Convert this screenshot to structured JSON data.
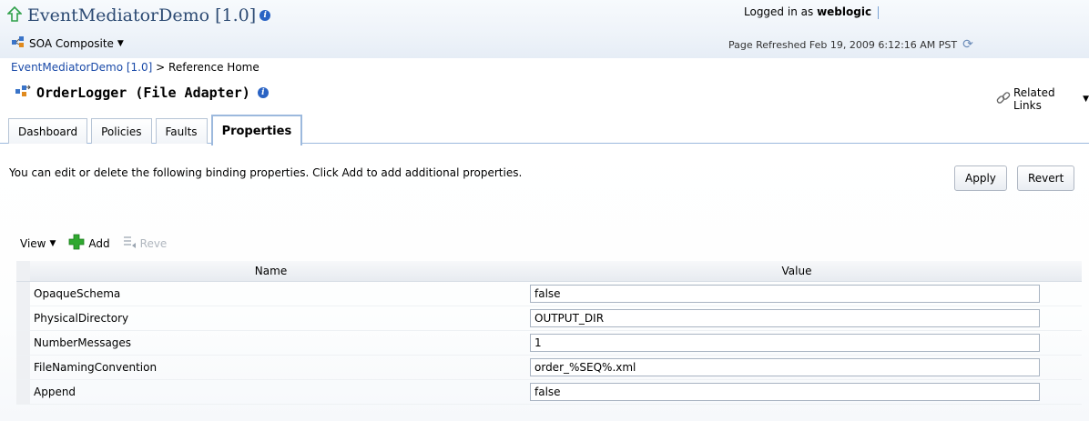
{
  "header": {
    "app_title": "EventMediatorDemo [1.0]",
    "composite_menu_label": "SOA Composite",
    "logged_in_prefix": "Logged in as",
    "user": "weblogic",
    "page_refreshed": "Page Refreshed Feb 19, 2009 6:12:16 AM PST"
  },
  "breadcrumb": {
    "link": "EventMediatorDemo [1.0]",
    "separator": ">",
    "current": "Reference Home"
  },
  "reference": {
    "title": "OrderLogger (File Adapter)",
    "related_links": "Related Links"
  },
  "tabs": [
    {
      "label": "Dashboard",
      "active": false
    },
    {
      "label": "Policies",
      "active": false
    },
    {
      "label": "Faults",
      "active": false
    },
    {
      "label": "Properties",
      "active": true
    }
  ],
  "properties": {
    "description": "You can edit or delete the following binding properties. Click Add to add additional properties.",
    "apply_label": "Apply",
    "revert_label": "Revert",
    "toolbar": {
      "view_label": "View",
      "add_label": "Add",
      "revert_label": "Reve"
    },
    "columns": [
      "Name",
      "Value"
    ],
    "rows": [
      {
        "name": "OpaqueSchema",
        "value": "false"
      },
      {
        "name": "PhysicalDirectory",
        "value": "OUTPUT_DIR"
      },
      {
        "name": "NumberMessages",
        "value": "1"
      },
      {
        "name": "FileNamingConvention",
        "value": "order_%SEQ%.xml"
      },
      {
        "name": "Append",
        "value": "false"
      }
    ]
  },
  "icons": {
    "home": "home-arrow-icon",
    "info": "info-icon",
    "composite": "composite-icon",
    "refresh": "refresh-icon",
    "adapter": "file-adapter-icon",
    "links": "chain-link-icon",
    "add": "add-plus-icon",
    "revert": "revert-list-icon"
  },
  "colors": {
    "header_bg": "#eef3f9",
    "title_text": "#2c4a73",
    "link": "#1a4aa8",
    "info_icon": "#2a63c4",
    "add_icon": "#2fa82f",
    "tab_border": "#9cb9dd"
  }
}
